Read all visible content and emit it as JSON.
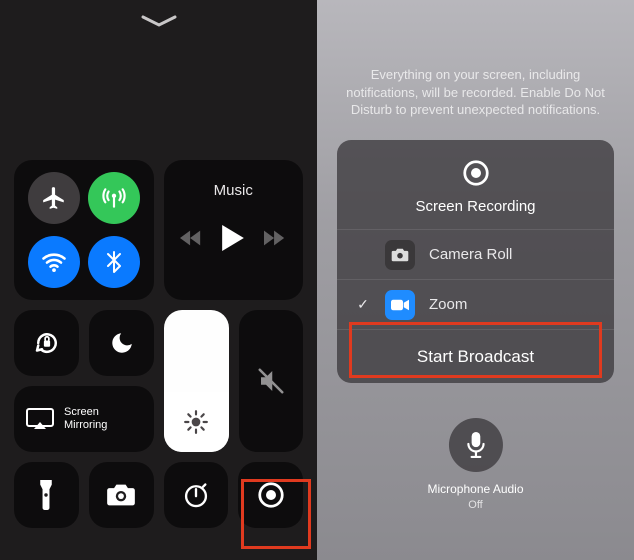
{
  "left_panel": {
    "music_label": "Music",
    "screen_mirroring_label": "Screen\nMirroring"
  },
  "right_panel": {
    "description": "Everything on your screen, including notifications, will be recorded. Enable Do Not Disturb to prevent unexpected notifications.",
    "sheet_title": "Screen Recording",
    "options": [
      {
        "label": "Camera Roll",
        "selected": false,
        "icon": "camera"
      },
      {
        "label": "Zoom",
        "selected": true,
        "icon": "zoom"
      }
    ],
    "action_label": "Start Broadcast",
    "mic_title": "Microphone Audio",
    "mic_status": "Off"
  }
}
